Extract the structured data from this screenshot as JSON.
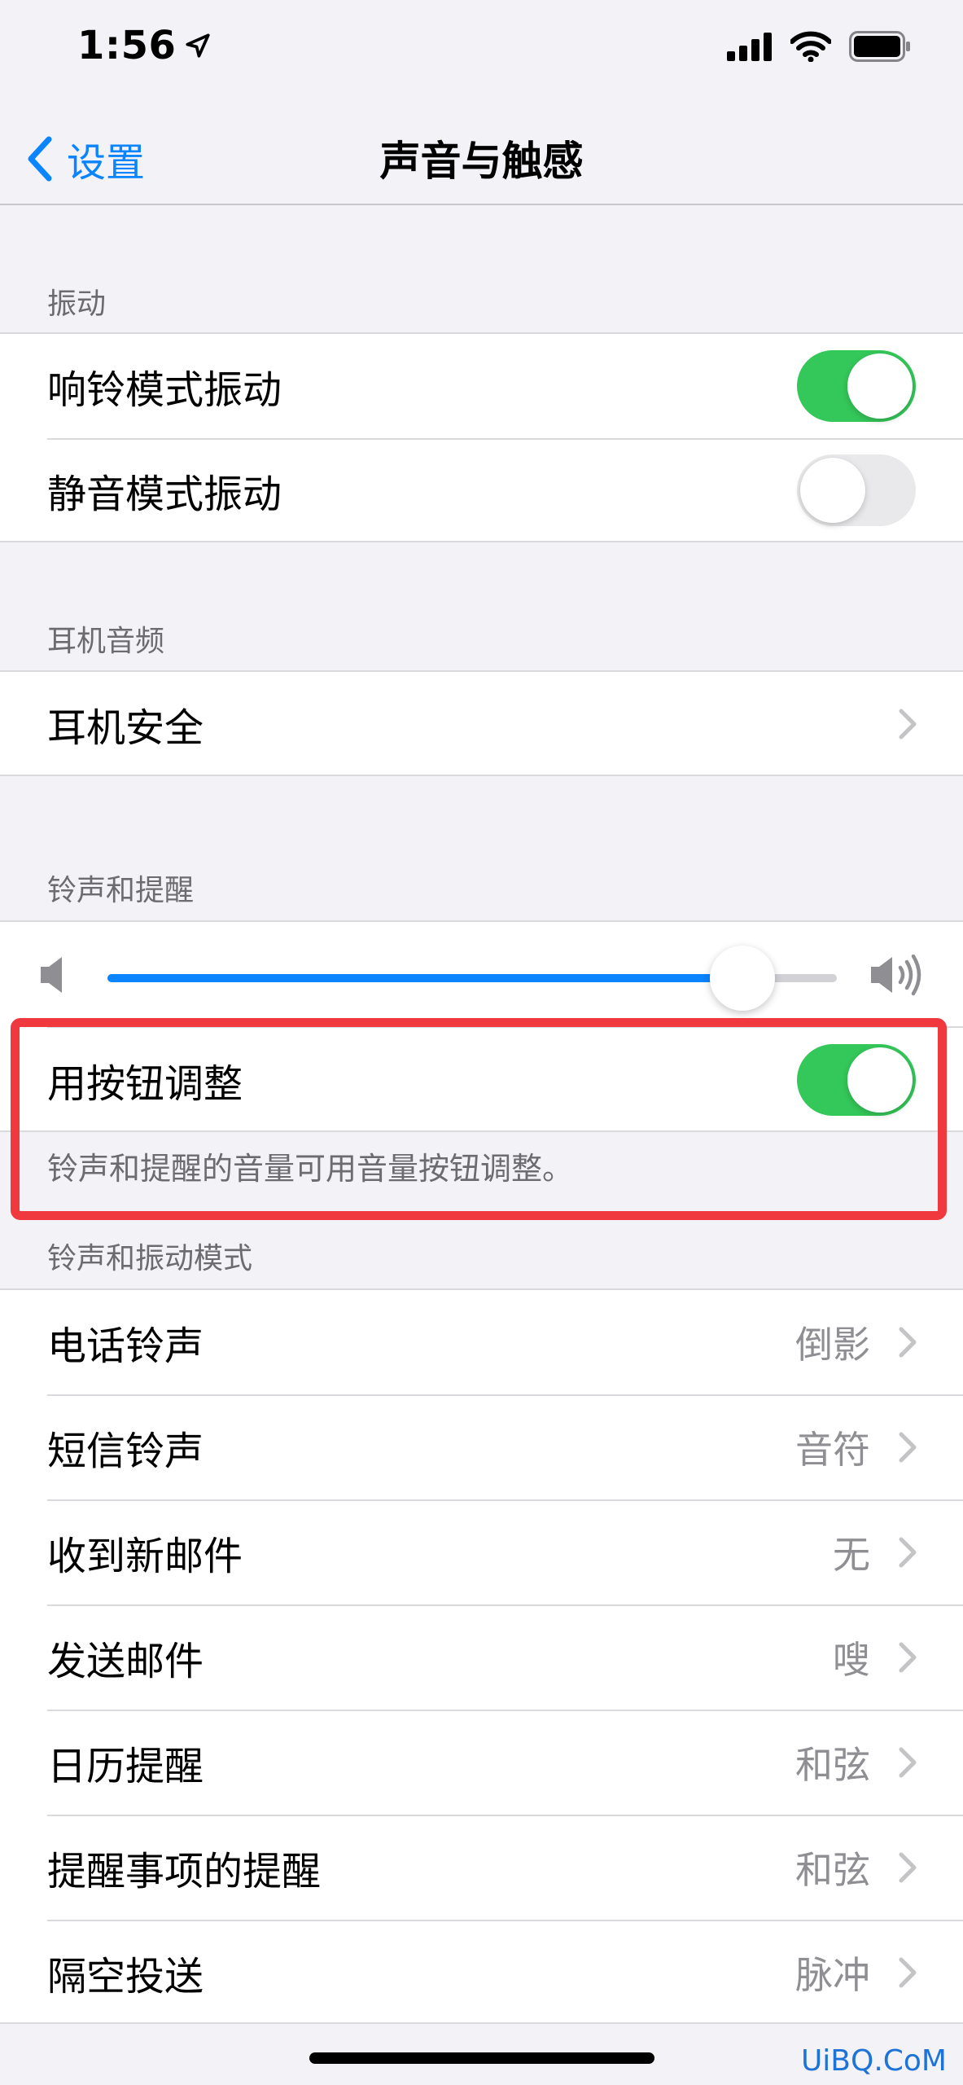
{
  "status": {
    "time": "1:56"
  },
  "nav": {
    "back_label": "设置",
    "title": "声音与触感"
  },
  "vibration": {
    "header": "振动",
    "ring_label": "响铃模式振动",
    "ring_on": true,
    "silent_label": "静音模式振动",
    "silent_on": false
  },
  "headphone": {
    "header": "耳机音频",
    "safety_label": "耳机安全"
  },
  "ringer": {
    "header": "铃声和提醒",
    "volume_fraction": 0.87,
    "change_with_buttons_label": "用按钮调整",
    "change_with_buttons_on": true,
    "footer": "铃声和提醒的音量可用音量按钮调整。"
  },
  "patterns": {
    "header": "铃声和振动模式",
    "items": [
      {
        "label": "电话铃声",
        "value": "倒影"
      },
      {
        "label": "短信铃声",
        "value": "音符"
      },
      {
        "label": "收到新邮件",
        "value": "无"
      },
      {
        "label": "发送邮件",
        "value": "嗖"
      },
      {
        "label": "日历提醒",
        "value": "和弦"
      },
      {
        "label": "提醒事项的提醒",
        "value": "和弦"
      },
      {
        "label": "隔空投送",
        "value": "脉冲"
      }
    ]
  },
  "watermark": "UiBQ.CoM",
  "colors": {
    "accent": "#0A84FF",
    "toggle_on": "#34C759",
    "highlight": "#F0383F"
  }
}
